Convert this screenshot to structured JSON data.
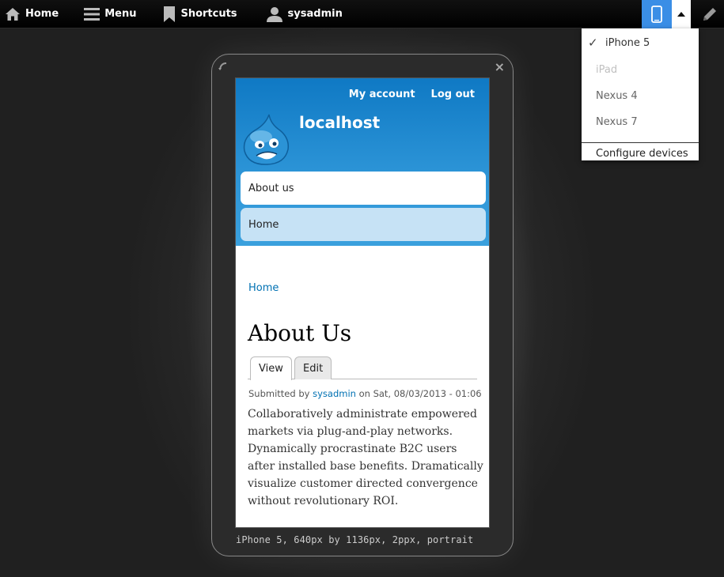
{
  "toolbar": {
    "home_label": "Home",
    "menu_label": "Menu",
    "shortcuts_label": "Shortcuts",
    "user_label": "sysadmin",
    "icons": [
      "home-icon",
      "menu-icon",
      "bookmark-icon",
      "user-icon",
      "phone-icon",
      "caret-up-icon",
      "pencil-icon"
    ],
    "accent_color": "#3a8ee6"
  },
  "device_menu": {
    "items": [
      {
        "label": "iPhone 5",
        "selected": true,
        "disabled": false
      },
      {
        "label": "iPad",
        "selected": false,
        "disabled": true
      },
      {
        "label": "Nexus 4",
        "selected": false,
        "disabled": false
      },
      {
        "label": "Nexus 7",
        "selected": false,
        "disabled": false
      }
    ],
    "configure_label": "Configure devices"
  },
  "device_frame": {
    "close_glyph": "×",
    "caption": "iPhone 5, 640px by 1136px, 2ppx, portrait"
  },
  "site": {
    "my_account": "My account",
    "log_out": "Log out",
    "site_name": "localhost",
    "nav": [
      "About us",
      "Home"
    ],
    "breadcrumb": "Home",
    "title": "About Us",
    "tabs": [
      "View",
      "Edit"
    ],
    "submitted_prefix": "Submitted by",
    "submitted_user": "sysadmin",
    "submitted_suffix": "on Sat, 08/03/2013 - 01:06",
    "body": "Collaboratively administrate empowered markets via plug-and-play networks. Dynamically procrastinate B2C users after installed base benefits. Dramatically visualize customer directed convergence without revolutionary ROI.",
    "header_color": "#1a83cc"
  }
}
